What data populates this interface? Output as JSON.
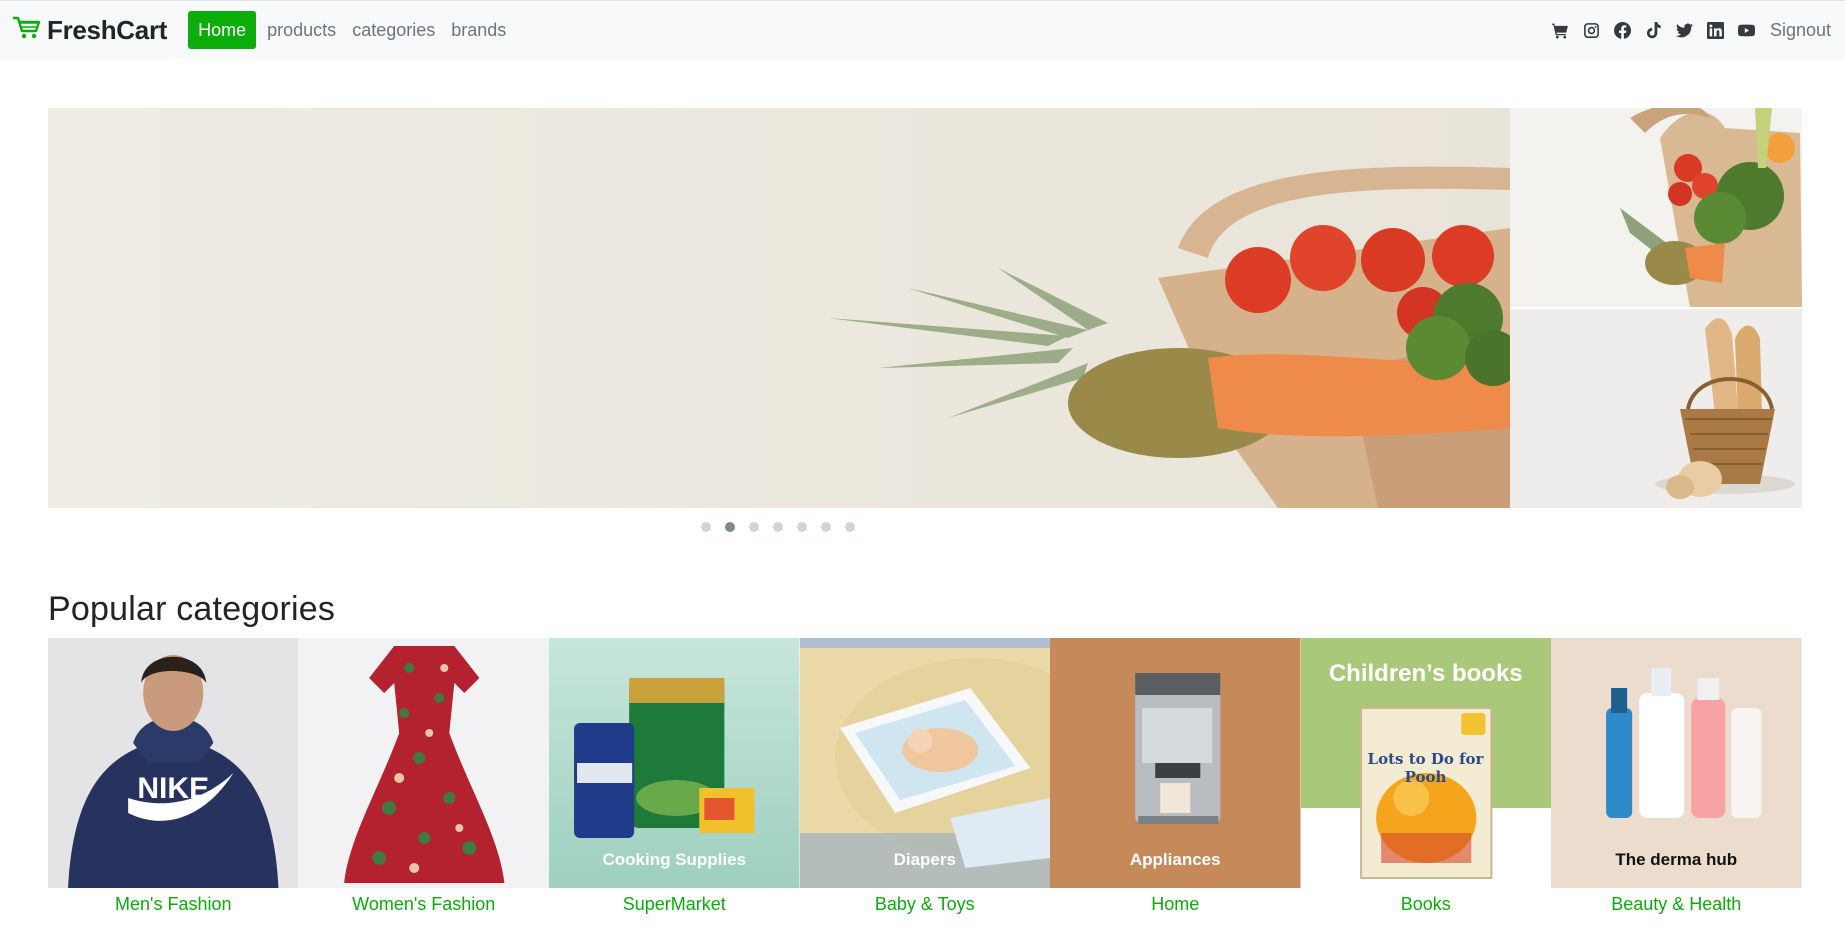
{
  "navbar": {
    "brand": "FreshCart",
    "links": [
      "Home",
      "products",
      "categories",
      "brands"
    ],
    "active_link": "Home",
    "icons": [
      "cart-icon",
      "instagram-icon",
      "facebook-icon",
      "tiktok-icon",
      "twitter-icon",
      "linkedin-icon",
      "youtube-icon"
    ],
    "signout": "Signout"
  },
  "slider": {
    "main_image": "grocery-bag-vegetables",
    "side_images": [
      "grocery-bag-vegetables-small",
      "bread-basket"
    ],
    "dot_count": 7,
    "active_dot": 2
  },
  "categories": {
    "title": "Popular categories",
    "items": [
      {
        "name": "Men's Fashion",
        "image": "man-nike-hoodie"
      },
      {
        "name": "Women's Fashion",
        "image": "floral-red-dress"
      },
      {
        "name": "SuperMarket",
        "image": "cooking-supplies",
        "overlay": "Cooking Supplies"
      },
      {
        "name": "Baby & Toys",
        "image": "diapers",
        "overlay": "Diapers"
      },
      {
        "name": "Home",
        "image": "coffee-machine",
        "overlay": "Appliances"
      },
      {
        "name": "Books",
        "image": "childrens-book",
        "overlay": "Children’s books",
        "book_title": "Lots to Do for Pooh"
      },
      {
        "name": "Beauty & Health",
        "image": "skincare-bottles",
        "overlay": "The derma hub"
      }
    ]
  },
  "colors": {
    "accent": "#0aad0a",
    "navbar_bg": "#f8f9fa",
    "text_muted": "#6c757d"
  }
}
